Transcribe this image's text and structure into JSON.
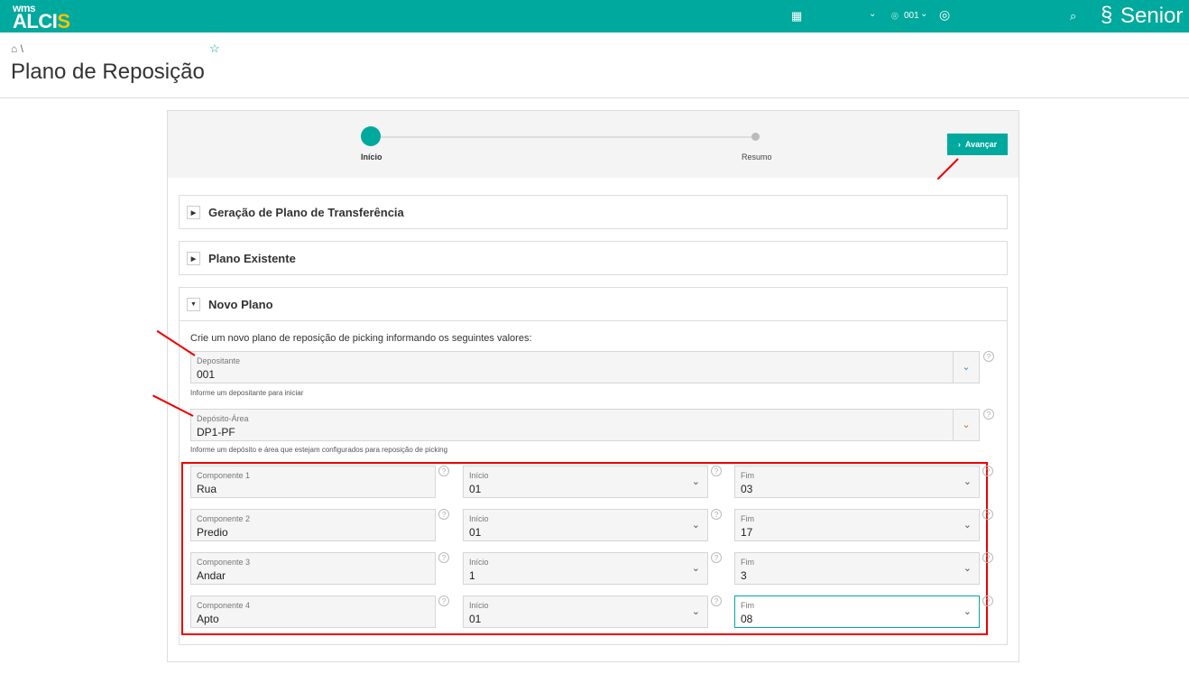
{
  "header": {
    "logo_top": "wms",
    "logo_main": "ALCI",
    "logo_accent": "S",
    "location": "001",
    "brand": "Senior"
  },
  "page": {
    "title": "Plano de Reposição",
    "breadcrumb_sep": "\\"
  },
  "stepper": {
    "steps": [
      "Início",
      "Resumo"
    ],
    "next_button": "Avançar"
  },
  "accordions": [
    {
      "title": "Geração de Plano de Transferência",
      "expanded": false
    },
    {
      "title": "Plano Existente",
      "expanded": false
    },
    {
      "title": "Novo Plano",
      "expanded": true
    }
  ],
  "novo_plano": {
    "intro": "Crie um novo plano de reposição de picking informando os seguintes valores:",
    "depositante": {
      "label": "Depositante",
      "value": "001",
      "hint": "Informe um depositante para iniciar"
    },
    "deposito_area": {
      "label": "Depósito-Área",
      "value": "DP1-PF",
      "hint": "Informe um depósito e área que estejam configurados para reposição de picking"
    },
    "componentes": [
      {
        "label": "Componente 1",
        "value": "Rua",
        "inicio_label": "Início",
        "inicio": "01",
        "fim_label": "Fim",
        "fim": "03"
      },
      {
        "label": "Componente 2",
        "value": "Predio",
        "inicio_label": "Início",
        "inicio": "01",
        "fim_label": "Fim",
        "fim": "17"
      },
      {
        "label": "Componente 3",
        "value": "Andar",
        "inicio_label": "Início",
        "inicio": "1",
        "fim_label": "Fim",
        "fim": "3"
      },
      {
        "label": "Componente 4",
        "value": "Apto",
        "inicio_label": "Início",
        "inicio": "01",
        "fim_label": "Fim",
        "fim": "08"
      }
    ]
  },
  "colors": {
    "brand": "#00a99d",
    "accent": "#f5c400",
    "highlight": "#e00000"
  }
}
